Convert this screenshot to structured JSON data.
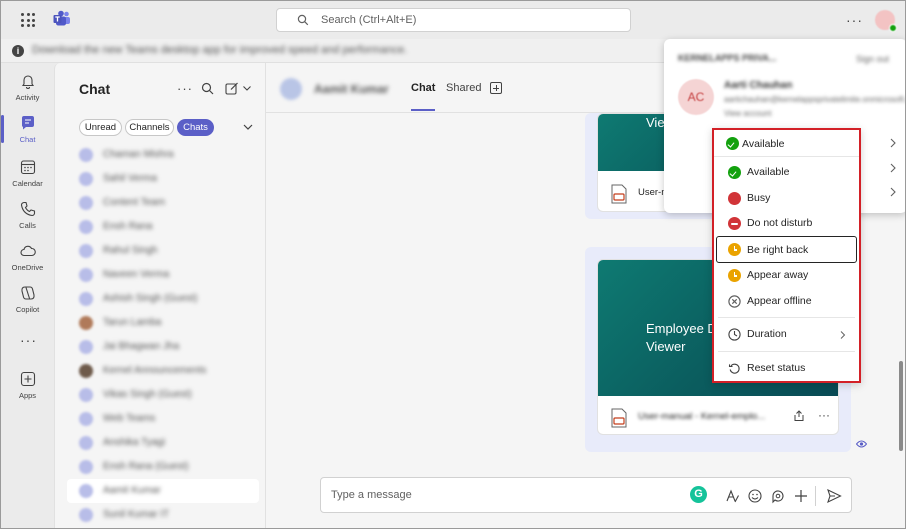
{
  "titlebar": {
    "search_placeholder": "Search (Ctrl+Alt+E)"
  },
  "infobar": {
    "message": "Download the new Teams desktop app for improved speed and performance."
  },
  "rail": {
    "items": [
      {
        "label": "Activity",
        "icon": "bell-icon"
      },
      {
        "label": "Chat",
        "icon": "chat-icon"
      },
      {
        "label": "Calendar",
        "icon": "calendar-icon"
      },
      {
        "label": "Calls",
        "icon": "phone-icon"
      },
      {
        "label": "OneDrive",
        "icon": "cloud-icon"
      },
      {
        "label": "Copilot",
        "icon": "copilot-icon"
      },
      {
        "label": "Apps",
        "icon": "add-square-icon"
      }
    ]
  },
  "chatpane": {
    "title": "Chat",
    "filters": [
      "Unread",
      "Channels",
      "Chats"
    ],
    "contacts": [
      "Chaman Mishra",
      "Sahil Verma",
      "Content Team",
      "Ensh Rana",
      "Rahul Singh",
      "Naveen Verma",
      "Ashish Singh (Guest)",
      "Tarun Lamba",
      "Jai Bhagwan Jha",
      "Kernel Announcements",
      "Vikas Singh (Guest)",
      "Web Teams",
      "Anshika Tyagi",
      "Ensh Rana (Guest)",
      "Aamit Kumar",
      "Sunil Kumar IT"
    ]
  },
  "main": {
    "contact_name": "Aamit Kumar",
    "tabs": [
      "Chat",
      "Shared"
    ],
    "file_card_1": {
      "preview_text": "Vie",
      "file_name_prefix": "User-m"
    },
    "file_card_2": {
      "preview_line1": "Employee D",
      "preview_line2": "Viewer",
      "file_name": "User-manual - Kernel-emplo..."
    },
    "compose_placeholder": "Type a message"
  },
  "profile_panel": {
    "org_name": "KERNELAPPS PRIVA...",
    "sign_out": "Sign out",
    "initials": "AC",
    "user_name": "Aarti Chauhan",
    "email": "aartichauhan@kernelappsprivatelimite.onmicrosoft.com",
    "view_account": "View account"
  },
  "status_menu": {
    "current": "Available",
    "options": [
      {
        "label": "Available",
        "status": "available"
      },
      {
        "label": "Busy",
        "status": "busy"
      },
      {
        "label": "Do not disturb",
        "status": "dnd"
      },
      {
        "label": "Be right back",
        "status": "brb"
      },
      {
        "label": "Appear away",
        "status": "away"
      },
      {
        "label": "Appear offline",
        "status": "offline"
      }
    ],
    "duration": "Duration",
    "reset": "Reset status"
  },
  "colors": {
    "accent": "#5b5fc7",
    "available": "#13a10e",
    "busy": "#d13438",
    "away": "#eaa300",
    "highlight_border": "#d32027"
  }
}
